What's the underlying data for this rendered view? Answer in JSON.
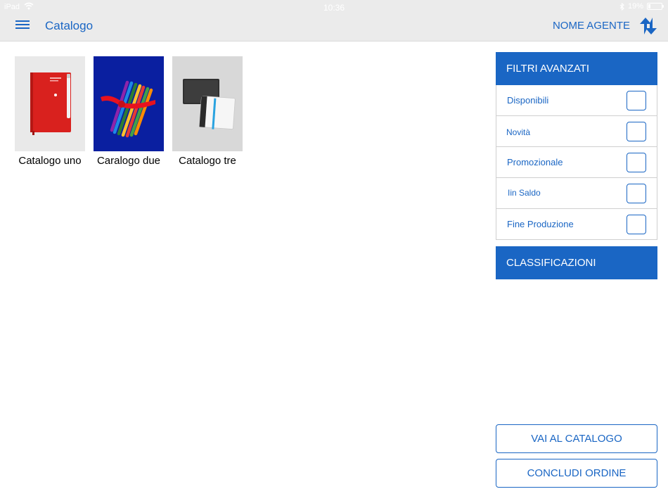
{
  "status_bar": {
    "carrier": "iPad",
    "time": "10:36",
    "battery": "19%",
    "battery_level": 0.19
  },
  "header": {
    "menu_icon": "hamburger-menu-icon",
    "title": "Catalogo",
    "agent_name": "NOME AGENTE",
    "sync_icon": "sync-arrows-icon"
  },
  "catalogs": [
    {
      "label": "Catalogo uno",
      "thumb": "red-notebook"
    },
    {
      "label": "Caralogo due",
      "thumb": "colored-pencils"
    },
    {
      "label": "Catalogo tre",
      "thumb": "black-notebooks"
    }
  ],
  "filters": {
    "title": "FILTRI AVANZATI",
    "items": [
      {
        "label": "Disponibili"
      },
      {
        "label": "Novità"
      },
      {
        "label": "Promozionale"
      },
      {
        "label": "Iin Saldo"
      },
      {
        "label": "Fine Produzione"
      }
    ]
  },
  "classifications": {
    "title": "CLASSIFICAZIONI"
  },
  "actions": {
    "goto_catalog": "VAI AL CATALOGO",
    "conclude_order": "CONCLUDI ORDINE"
  },
  "colors": {
    "accent": "#1a66c4",
    "header_bg": "#ebebeb"
  }
}
